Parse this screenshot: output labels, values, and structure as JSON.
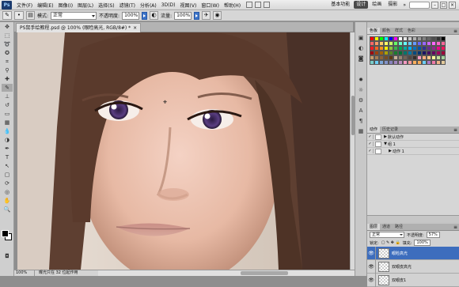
{
  "app": {
    "logo": "Ps"
  },
  "menu": [
    "文件(F)",
    "编辑(E)",
    "图像(I)",
    "图层(L)",
    "选择(S)",
    "滤镜(T)",
    "分析(A)",
    "3D(D)",
    "视图(V)",
    "窗口(W)",
    "帮助(H)"
  ],
  "workspace": {
    "basic": "基本功能",
    "design": "设计",
    "paint": "绘画",
    "photo": "摄影",
    "more": "»"
  },
  "options": {
    "mode_label": "模式:",
    "mode_value": "正常",
    "opacity_label": "不透明度:",
    "opacity_value": "100%",
    "flow_label": "流量:",
    "flow_value": "100%"
  },
  "document": {
    "tab_title": "PS鼠手绘教程.psd @ 100% (眼睑高光, RGB/8#) *",
    "close": "×"
  },
  "status": {
    "zoom": "100%",
    "info": "曝光只在 32 位起作用"
  },
  "swatches_panel": {
    "tabs": [
      "色板",
      "颜色",
      "样式",
      "色彩"
    ],
    "colors": [
      "#ff0000",
      "#ffff00",
      "#00ff00",
      "#00ffff",
      "#0000ff",
      "#ff00ff",
      "#ffffff",
      "#e6e6e6",
      "#cccccc",
      "#b3b3b3",
      "#999999",
      "#808080",
      "#666666",
      "#4d4d4d",
      "#333333",
      "#000000",
      "#ff6666",
      "#ff9966",
      "#ffcc66",
      "#ffff66",
      "#ccff66",
      "#66ff66",
      "#66ffcc",
      "#66ffff",
      "#66ccff",
      "#6699ff",
      "#6666ff",
      "#9966ff",
      "#cc66ff",
      "#ff66ff",
      "#ff66cc",
      "#ff6699",
      "#ee1c24",
      "#f26522",
      "#f7941d",
      "#fff200",
      "#8dc63f",
      "#39b54a",
      "#00a651",
      "#00a99d",
      "#00aeef",
      "#0072bc",
      "#0054a6",
      "#2e3192",
      "#662d91",
      "#92278f",
      "#ec008c",
      "#ed145b",
      "#9e0b0f",
      "#a0410d",
      "#a36209",
      "#aba000",
      "#598527",
      "#197b30",
      "#007236",
      "#00746b",
      "#0076a3",
      "#004b80",
      "#003471",
      "#1b1464",
      "#440e62",
      "#630460",
      "#9e005d",
      "#9e0039",
      "#c69c6d",
      "#a67c52",
      "#8c6239",
      "#754c24",
      "#603913",
      "#c7b299",
      "#998675",
      "#736357",
      "#534741",
      "#362f2d",
      "#f49ac1",
      "#f9ad81",
      "#fdc68a",
      "#fff799",
      "#c4df9b",
      "#a3d39c",
      "#7accc8",
      "#6dcff6",
      "#7da7d9",
      "#8393ca",
      "#8781bd",
      "#a186be",
      "#bd8cbf",
      "#f49ac2",
      "#f6989d",
      "#fbaf5d",
      "#f8ac59",
      "#6ecff6",
      "#ab7ac7",
      "#ee7aa8",
      "#f0b487",
      "#e3ca9b"
    ]
  },
  "actions_panel": {
    "tabs": [
      "动作",
      "历史记录"
    ],
    "rows": [
      "默认动作",
      "组 1",
      "动作 1"
    ]
  },
  "layers_panel": {
    "tabs": [
      "图层",
      "通道",
      "路径"
    ],
    "blend": "正常",
    "opacity_label": "不透明度:",
    "opacity": "57%",
    "lock_label": "锁定:",
    "fill_label": "填充:",
    "fill": "100%",
    "layers": [
      {
        "name": "眼睑高光",
        "selected": true
      },
      {
        "name": "双眼皮高光",
        "selected": false
      },
      {
        "name": "双眼皮1",
        "selected": false
      }
    ]
  }
}
